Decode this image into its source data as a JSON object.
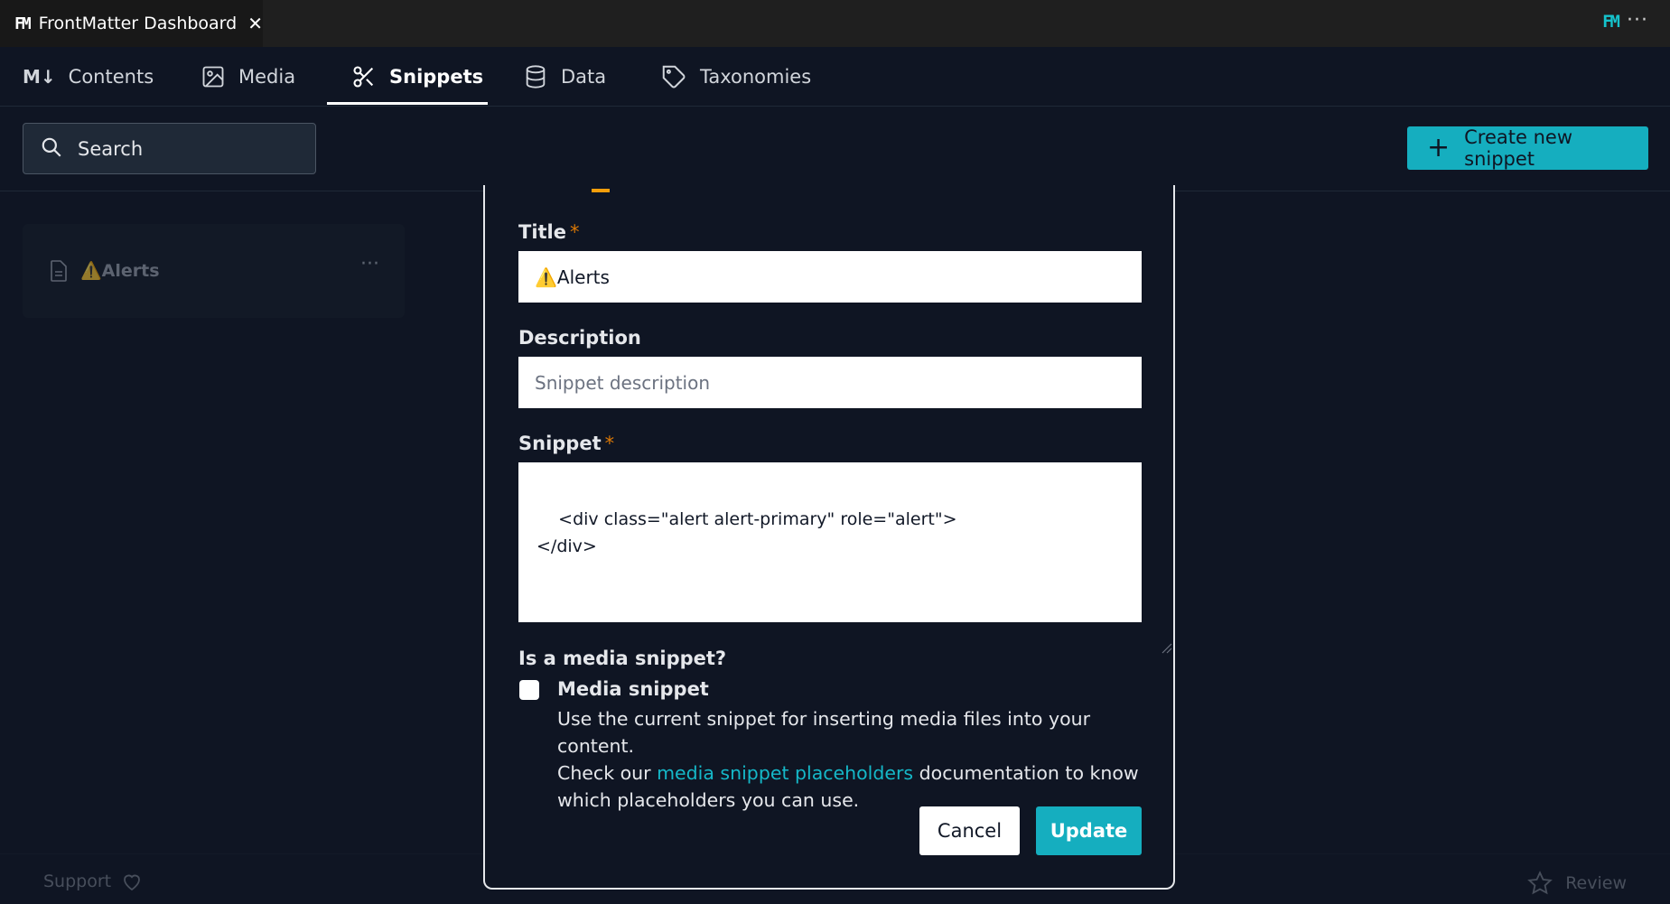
{
  "window": {
    "tab_title": "FrontMatter Dashboard",
    "close_glyph": "✕",
    "logo_text": "FM",
    "right_logo_text": "FM",
    "more_glyph": "···"
  },
  "nav": {
    "tabs": [
      {
        "label": "Contents",
        "icon": "markdown-icon",
        "icon_text": "M↓"
      },
      {
        "label": "Media",
        "icon": "image-icon"
      },
      {
        "label": "Snippets",
        "icon": "scissors-icon",
        "active": true
      },
      {
        "label": "Data",
        "icon": "database-icon"
      },
      {
        "label": "Taxonomies",
        "icon": "tag-icon"
      }
    ]
  },
  "toolbar": {
    "search_placeholder": "Search",
    "create_label": "Create new snippet",
    "create_glyph": "+"
  },
  "snippet_card": {
    "title": "⚠️Alerts",
    "more_glyph": "···"
  },
  "footer": {
    "support_label": "Support",
    "review_label": "Review"
  },
  "dialog": {
    "title_label": "Title",
    "title_value": "⚠️Alerts",
    "description_label": "Description",
    "description_placeholder": "Snippet description",
    "snippet_label": "Snippet",
    "snippet_value": "<div class=\"alert alert-primary\" role=\"alert\">\n</div>",
    "required_mark": "*",
    "media_question": "Is a media snippet?",
    "media_checkbox_label": "Media snippet",
    "media_checked": false,
    "media_desc_1": "Use the current snippet for inserting media files into your content.",
    "media_desc_2_pre": "Check our ",
    "media_desc_link": "media snippet placeholders",
    "media_desc_2_post": " documentation to know which placeholders you can use.",
    "cancel_label": "Cancel",
    "update_label": "Update"
  },
  "colors": {
    "accent": "#15aebf",
    "background": "#0f1523",
    "required": "#d97706"
  }
}
